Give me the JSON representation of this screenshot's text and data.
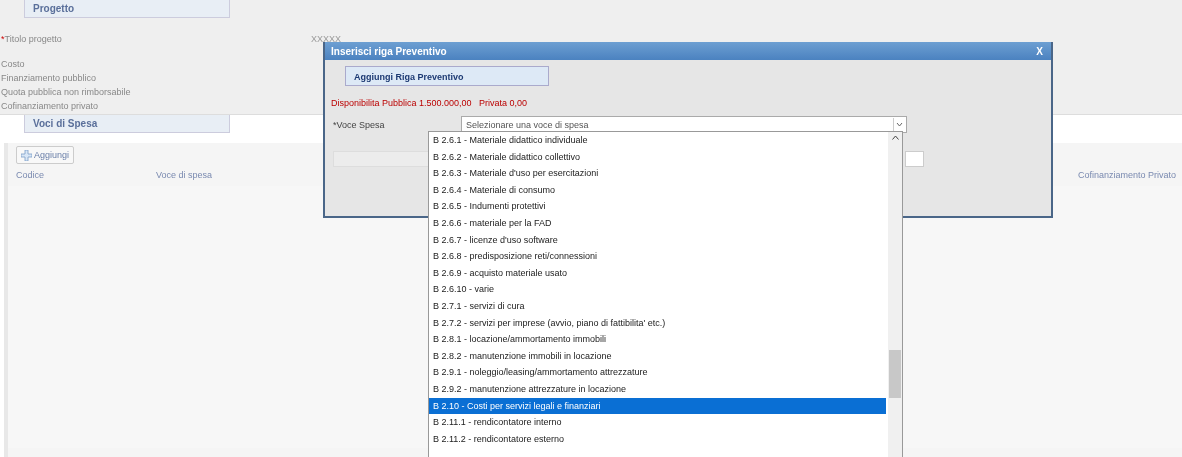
{
  "project_section": {
    "title": "Progetto",
    "fields": [
      {
        "label": "Titolo progetto",
        "required_mark": "*",
        "value": "XXXXX"
      },
      {
        "label": "Costo"
      },
      {
        "label": "Finanziamento pubblico"
      },
      {
        "label": "Quota pubblica non rimborsabile"
      },
      {
        "label": "Cofinanziamento privato"
      }
    ]
  },
  "expense_section": {
    "title": "Voci di Spesa",
    "add_button": "Aggiungi",
    "columns": [
      "Codice",
      "Voce di spesa",
      "Cofinanziamento Privato"
    ]
  },
  "dialog": {
    "title": "Inserisci riga Preventivo",
    "close": "X",
    "tab": "Aggiungi Riga Preventivo",
    "availability": "Disponibilita Pubblica 1.500.000,00   Privata 0,00",
    "voce_label": "Voce Spesa",
    "voce_required_mark": "*",
    "select_value": "Selezionare una voce di spesa",
    "options": [
      {
        "label": "B 2.6.1 - Materiale didattico individuale",
        "selected": false
      },
      {
        "label": "B 2.6.2 - Materiale didattico collettivo",
        "selected": false
      },
      {
        "label": "B 2.6.3 - Materiale d'uso per esercitazioni",
        "selected": false
      },
      {
        "label": "B 2.6.4 - Materiale di consumo",
        "selected": false
      },
      {
        "label": "B 2.6.5 - Indumenti protettivi",
        "selected": false
      },
      {
        "label": "B 2.6.6 - materiale per la FAD",
        "selected": false
      },
      {
        "label": "B 2.6.7 - licenze d'uso software",
        "selected": false
      },
      {
        "label": "B 2.6.8 - predisposizione reti/connessioni",
        "selected": false
      },
      {
        "label": "B 2.6.9 - acquisto materiale usato",
        "selected": false
      },
      {
        "label": "B 2.6.10 - varie",
        "selected": false
      },
      {
        "label": "B 2.7.1 - servizi di cura",
        "selected": false
      },
      {
        "label": "B 2.7.2 - servizi per imprese (avvio, piano di fattibilita' etc.)",
        "selected": false
      },
      {
        "label": "B 2.8.1 - locazione/ammortamento immobili",
        "selected": false
      },
      {
        "label": "B 2.8.2 - manutenzione immobili in locazione",
        "selected": false
      },
      {
        "label": "B 2.9.1 - noleggio/leasing/ammortamento attrezzature",
        "selected": false
      },
      {
        "label": "B 2.9.2 - manutenzione attrezzature in locazione",
        "selected": false
      },
      {
        "label": "B 2.10 - Costi per servizi legali e finanziari",
        "selected": true
      },
      {
        "label": "B 2.11.1 - rendicontatore interno",
        "selected": false
      },
      {
        "label": "B 2.11.2 - rendicontatore esterno",
        "selected": false
      }
    ]
  }
}
